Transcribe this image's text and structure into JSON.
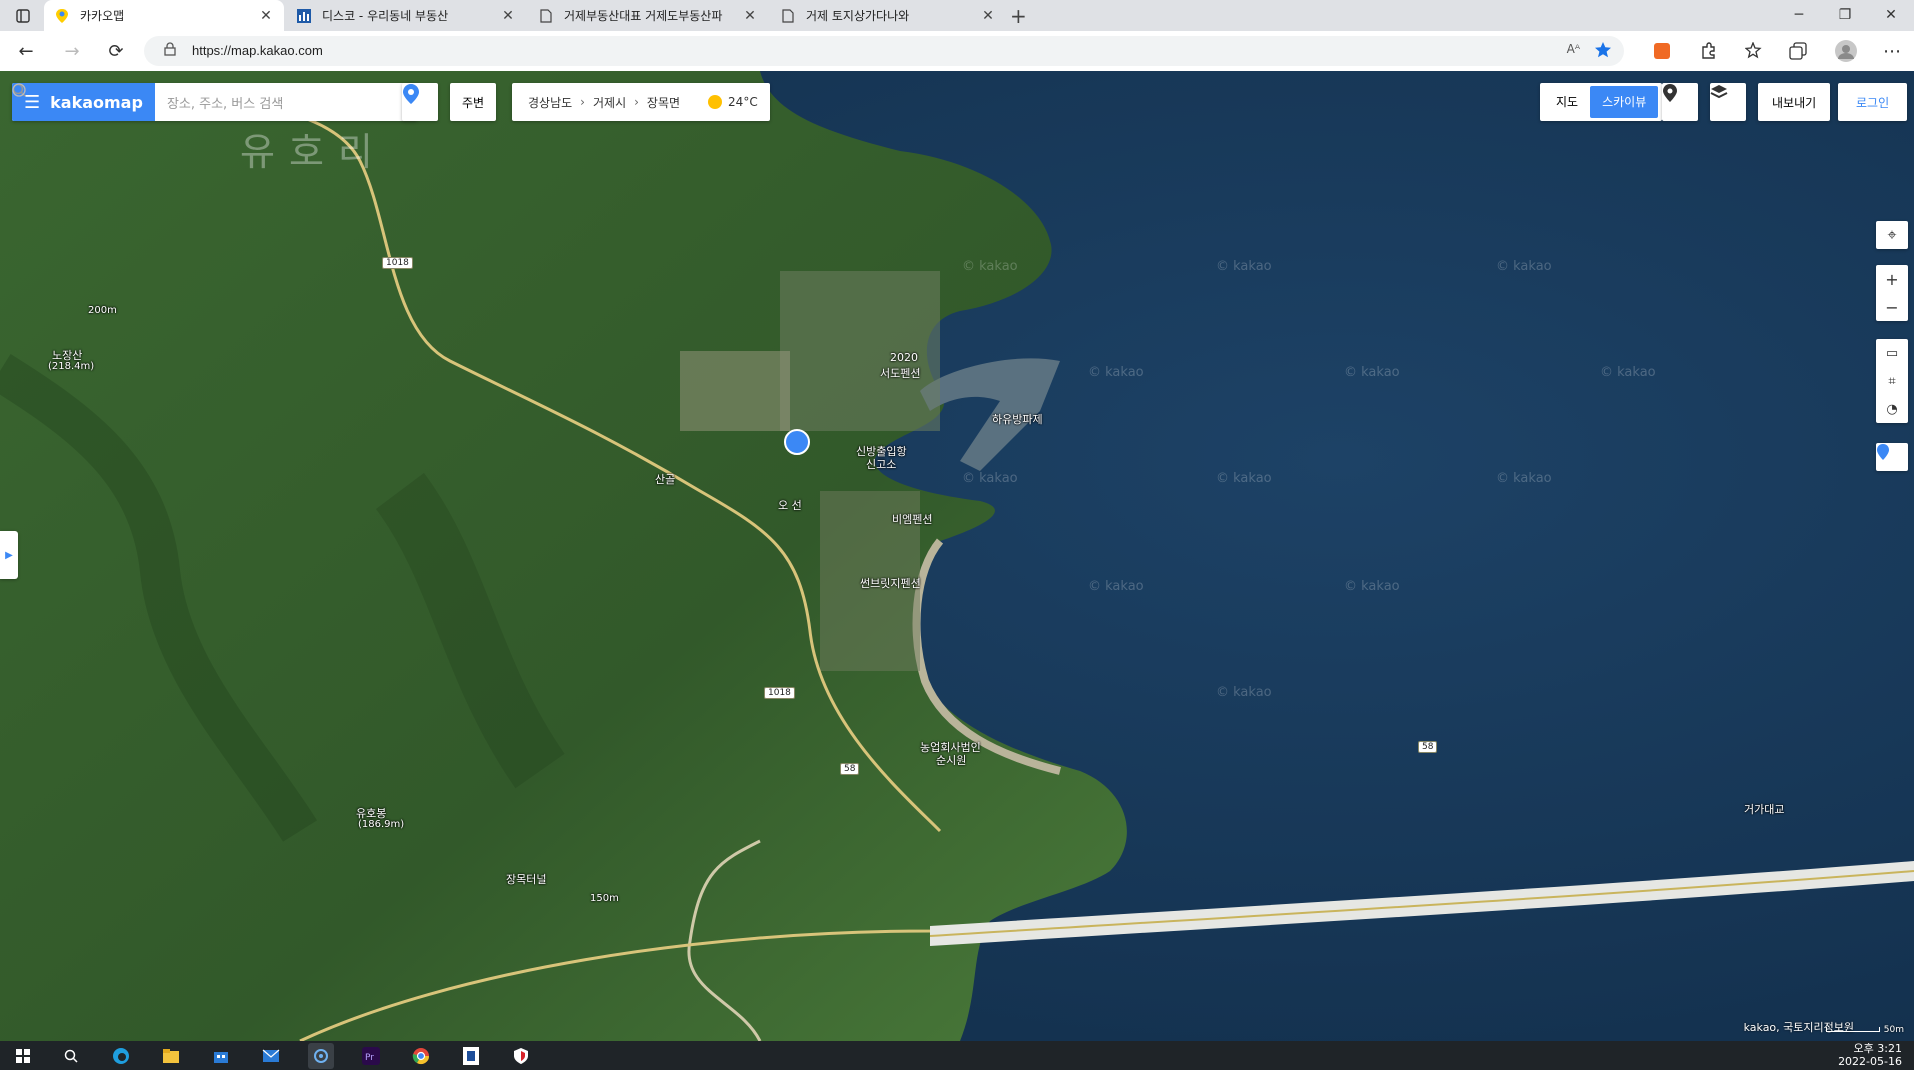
{
  "browser": {
    "tabs": [
      {
        "label": "카카오맵"
      },
      {
        "label": "디스코 - 우리동네 부동산"
      },
      {
        "label": "거제부동산대표 거제도부동산파"
      },
      {
        "label": "거제 토지상가다나와"
      }
    ],
    "url": "https://map.kakao.com",
    "read_aloud_label": "Aᴬ"
  },
  "map": {
    "logo": "kakaomap",
    "search_placeholder": "장소, 주소, 버스 검색",
    "nearby_label": "주변",
    "breadcrumb": [
      "경상남도",
      "거제시",
      "장목면"
    ],
    "weather": "24°C",
    "view_map_label": "지도",
    "view_skyview_label": "스카이뷰",
    "export_label": "내보내기",
    "login_label": "로그인",
    "region_name": "유호리",
    "labels": {
      "nojangsan": "노장산",
      "nojangsan_elev": "(218.4m)",
      "contour_200": "200m",
      "contour_150": "150m",
      "sangol": "산골",
      "pension_2020": "2020",
      "pension_2020b": "서도펜션",
      "breakwater": "하유방파제",
      "sinbangchurang": "신방출입항",
      "sinbang2": "신고소",
      "bm_pension": "비엠펜션",
      "sunbridge_pension": "썬브릿지펜션",
      "farm_corp": "농업회사법인",
      "farm_corp2": "순시원",
      "yuhobong": "유호봉",
      "yuhobong_elev": "(186.9m)",
      "jangmok_tunnel": "장목터널",
      "geoga_bridge": "거가대교",
      "bus_stop_partial": "오    선"
    },
    "road_1018": "1018",
    "road_58": "58",
    "watermark": "© kakao",
    "credit": "kakao, 국토지리정보원",
    "scale_label": "50m"
  },
  "taskbar": {
    "time": "오후 3:21",
    "date": "2022-05-16"
  },
  "colors": {
    "kakao_blue": "#3b88f5",
    "sea": "#1a3a5a",
    "land": "#3f6a32"
  }
}
